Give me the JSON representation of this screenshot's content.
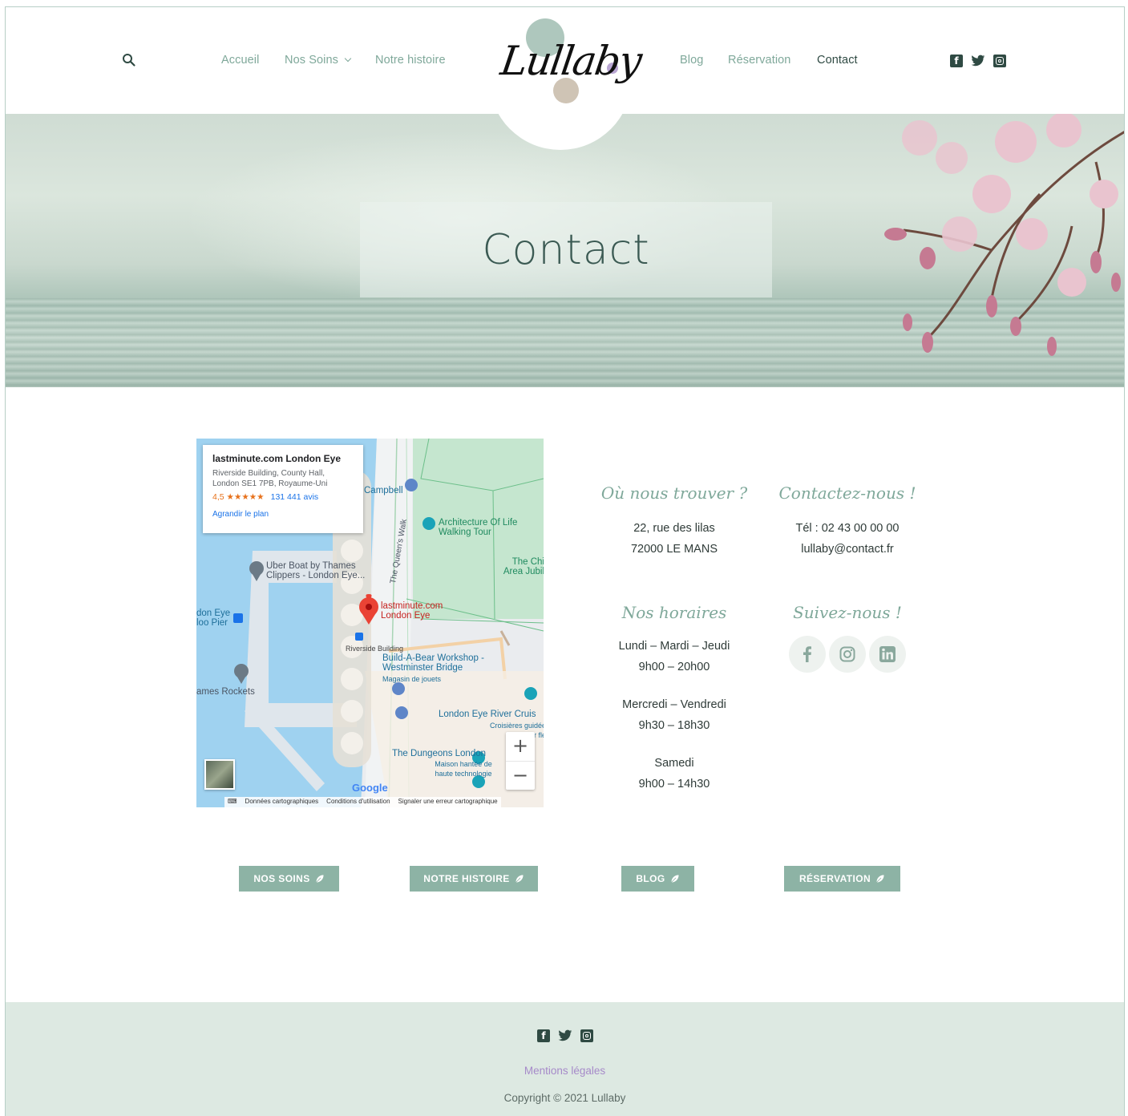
{
  "nav": {
    "left": [
      "Accueil",
      "Nos Soins",
      "Notre histoire"
    ],
    "right": [
      "Blog",
      "Réservation",
      "Contact"
    ],
    "active": "Contact"
  },
  "logo": {
    "text": "Lullaby"
  },
  "hero": {
    "title": "Contact"
  },
  "map": {
    "card_title": "lastminute.com London Eye",
    "card_address": "Riverside Building, County Hall, London SE1 7PB, Royaume-Uni",
    "rating": "4,5",
    "stars": "★★★★★",
    "reviews": "131 441 avis",
    "enlarge": "Agrandir le plan",
    "labels": {
      "campbell": "Campbell",
      "queens_walk": "The Queen's Walk",
      "architecture": "Architecture Of Life Walking Tour",
      "chi": "The Chi Area Jubil",
      "uber_boat": "Uber Boat by Thames Clippers - London Eye...",
      "pier": "don Eye loo Pier",
      "lastminute": "lastminute.com London Eye",
      "riverside": "Riverside Building",
      "build_bear": "Build-A-Bear Workshop - Westminster Bridge",
      "magasin": "Magasin de jouets",
      "rockets": "ames Rockets",
      "river_cruise": "London Eye River Cruis",
      "croisieres": "Croisières guidée sur fle",
      "dungeons": "The Dungeons London",
      "maison": "Maison hantée de haute technologie",
      "walk": "Walk",
      "google": "Google"
    },
    "footer": [
      "Données cartographiques",
      "Conditions d'utilisation",
      "Signaler une erreur cartographique"
    ]
  },
  "find_us": {
    "title": "Où nous trouver ?",
    "line1": "22, rue des lilas",
    "line2": "72000 LE MANS"
  },
  "contact_us": {
    "title": "Contactez-nous !",
    "phone": "Tél : 02 43 00 00 00",
    "email": "lullaby@contact.fr"
  },
  "hours": {
    "title": "Nos horaires",
    "block1_days": "Lundi – Mardi – Jeudi",
    "block1_time": "9h00 – 20h00",
    "block2_days": "Mercredi – Vendredi",
    "block2_time": "9h30 – 18h30",
    "block3_days": "Samedi",
    "block3_time": "9h00 – 14h30"
  },
  "follow_us": {
    "title": "Suivez-nous !",
    "icons": [
      "facebook-icon",
      "instagram-icon",
      "linkedin-icon"
    ]
  },
  "buttons": [
    "NOS SOINS",
    "NOTRE HISTOIRE",
    "BLOG",
    "RÉSERVATION"
  ],
  "footer": {
    "legal": "Mentions légales",
    "copyright": "Copyright © 2021 Lullaby"
  },
  "colors": {
    "accent": "#7fa89a",
    "dark": "#2f4a43",
    "button": "#8db3a5",
    "footer_bg": "#dde9e2",
    "legal": "#a68ac9"
  }
}
